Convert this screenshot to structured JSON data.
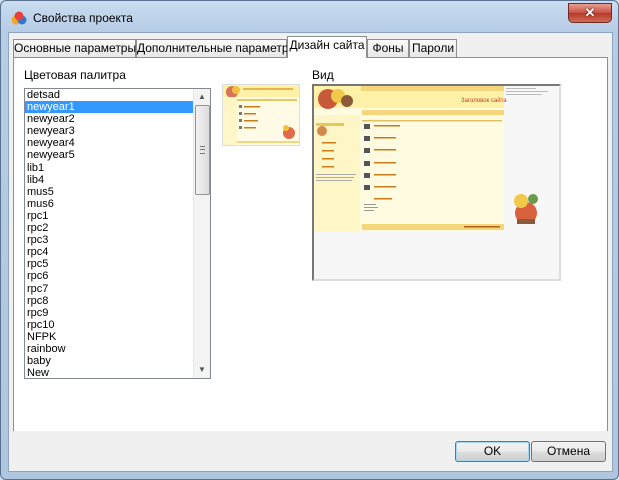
{
  "window": {
    "title": "Свойства проекта",
    "close_label": "✕"
  },
  "tabs": [
    "Основные параметры",
    "Дополнительные параметры",
    "Дизайн сайта",
    "Фоны",
    "Пароли"
  ],
  "active_tab": "Дизайн сайта",
  "palette": {
    "label": "Цветовая палитра",
    "selected": "newyear1",
    "items": [
      "detsad",
      "newyear1",
      "newyear2",
      "newyear3",
      "newyear4",
      "newyear5",
      "lib1",
      "lib4",
      "mus5",
      "mus6",
      "rpc1",
      "rpc2",
      "rpc3",
      "rpc4",
      "rpc5",
      "rpc6",
      "rpc7",
      "rpc8",
      "rpc9",
      "rpc10",
      "NFPK",
      "rainbow",
      "baby",
      "New"
    ]
  },
  "preview": {
    "label": "Вид",
    "site_title": "Заголовок сайта"
  },
  "buttons": {
    "ok": "OK",
    "cancel": "Отмена"
  },
  "colors": {
    "selection": "#3399ff",
    "preview_yellow": "#fff2a8",
    "preview_header": "#f4d77a"
  }
}
